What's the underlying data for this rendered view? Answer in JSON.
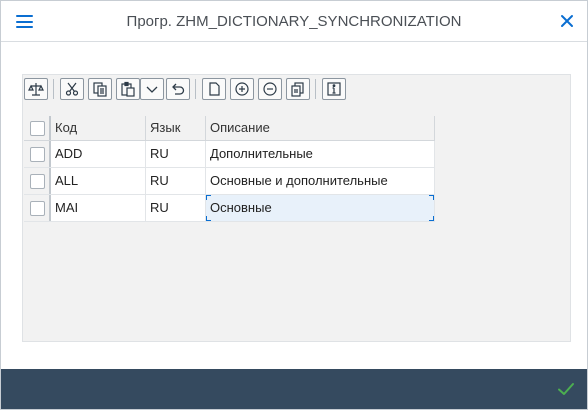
{
  "dialog": {
    "title": "Прогр. ZHM_DICTIONARY_SYNCHRONIZATION"
  },
  "toolbar": {
    "buttons": [
      {
        "icon": "balance-scale-icon"
      },
      {
        "icon": "cut-icon"
      },
      {
        "icon": "copy-icon"
      },
      {
        "icon": "paste-icon"
      },
      {
        "icon": "chevron-down-icon"
      },
      {
        "icon": "undo-icon"
      },
      {
        "icon": "new-page-icon"
      },
      {
        "icon": "add-circle-icon"
      },
      {
        "icon": "remove-circle-icon"
      },
      {
        "icon": "duplicate-icon"
      },
      {
        "icon": "info-icon"
      }
    ]
  },
  "table": {
    "columns": [
      "Код",
      "Язык",
      "Описание"
    ],
    "rows": [
      {
        "code": "ADD",
        "lang": "RU",
        "desc": "Дополнительные"
      },
      {
        "code": "ALL",
        "lang": "RU",
        "desc": "Основные и дополнительные"
      },
      {
        "code": "MAI",
        "lang": "RU",
        "desc": "Основные"
      }
    ],
    "focused_row": 2
  },
  "colors": {
    "accent": "#0a6ed1",
    "footer": "#354a5f",
    "ok": "#4caf50"
  }
}
